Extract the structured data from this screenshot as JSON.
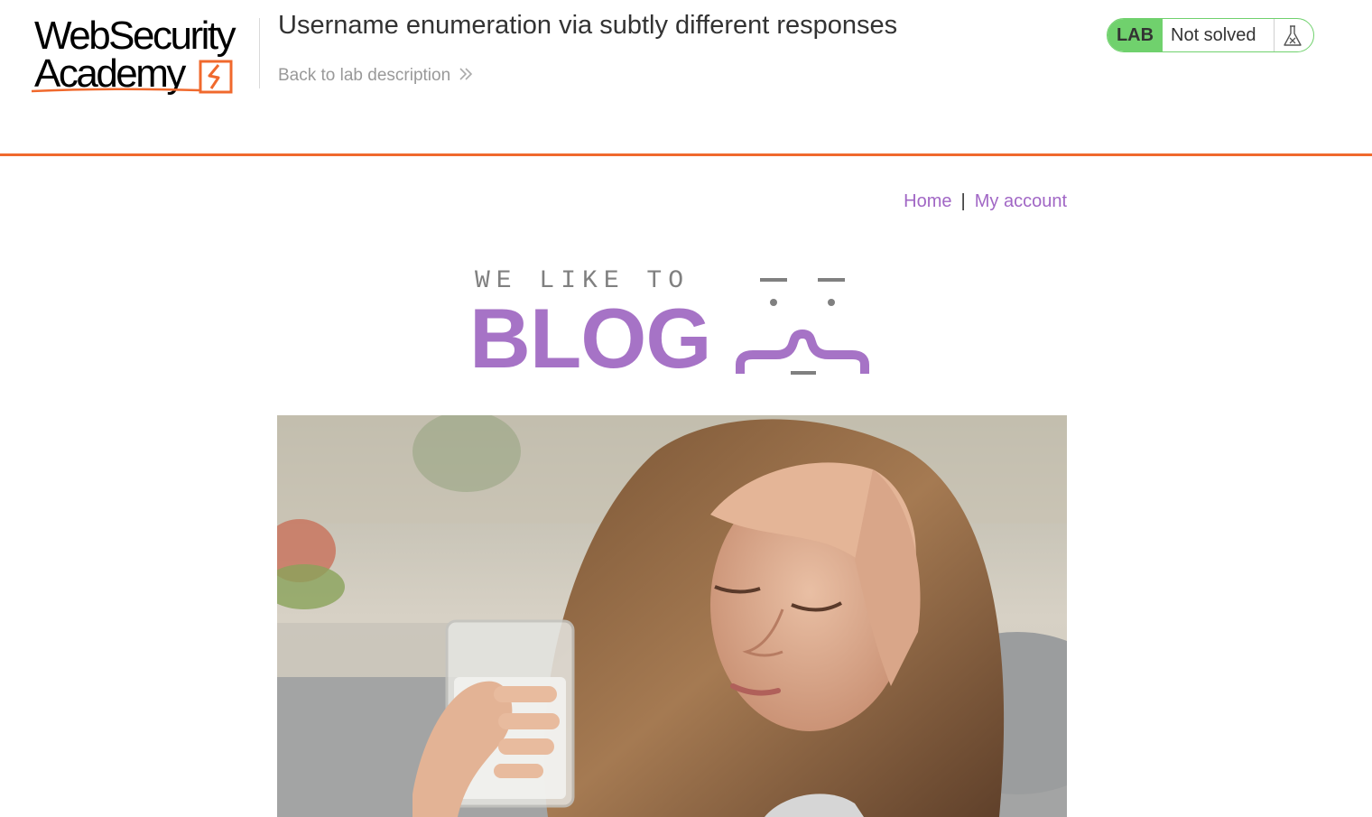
{
  "header": {
    "logo": {
      "line1": "WebSecurity",
      "line2": "Academy"
    },
    "lab_title": "Username enumeration via subtly different responses",
    "back_link": "Back to lab description",
    "status": {
      "badge": "LAB",
      "text": "Not solved",
      "icon": "flask-icon"
    }
  },
  "nav": {
    "home": "Home",
    "separator": "|",
    "account": "My account"
  },
  "banner": {
    "small_text": "WE LIKE TO",
    "big_text": "BLOG"
  },
  "hero_image": {
    "subject": "woman with headache holding glass of water"
  },
  "colors": {
    "accent_orange": "#f0692d",
    "link_purple": "#a167c5",
    "blog_purple": "#a673c6",
    "status_green": "#70d16d"
  }
}
